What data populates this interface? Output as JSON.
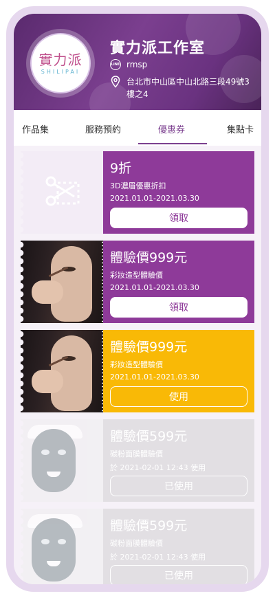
{
  "shop": {
    "logo_main": "實力派",
    "logo_sub": "SHILIPAI",
    "name": "實力派工作室",
    "line_icon": "LINE",
    "line_id": "rmsp",
    "address": "台北市中山區中山北路三段49號3樓之4"
  },
  "tabs": [
    {
      "label": "作品集"
    },
    {
      "label": "服務預約"
    },
    {
      "label": "優惠券"
    },
    {
      "label": "集點卡"
    }
  ],
  "active_tab": "優惠券",
  "coupons": [
    {
      "title": "9折",
      "desc": "3D濃眉優惠折扣",
      "date": "2021.01.01-2021.03.30",
      "button": "領取",
      "style": "purple",
      "image": "scissors-icon"
    },
    {
      "title": "體驗價999元",
      "desc": "彩妝造型體驗價",
      "date": "2021.01.01-2021.03.30",
      "button": "領取",
      "style": "purple",
      "image": "makeup-photo"
    },
    {
      "title": "體驗價999元",
      "desc": "彩妝造型體驗價",
      "date": "2021.01.01-2021.03.30",
      "button": "使用",
      "style": "yellow",
      "image": "makeup-photo"
    },
    {
      "title": "體驗價599元",
      "desc": "碳粉面膜體驗價",
      "date": "於 2021-02-01 12:43 使用",
      "button": "已使用",
      "style": "used",
      "image": "face-mask-photo"
    },
    {
      "title": "體驗價599元",
      "desc": "碳粉面膜體驗價",
      "date": "於 2021-02-01 12:43 使用",
      "button": "已使用",
      "style": "used",
      "image": "face-mask-photo"
    }
  ],
  "colors": {
    "purple": "#8e3a99",
    "yellow": "#f9b906",
    "used": "#e2dfe3",
    "accent": "#7b3f8f"
  }
}
